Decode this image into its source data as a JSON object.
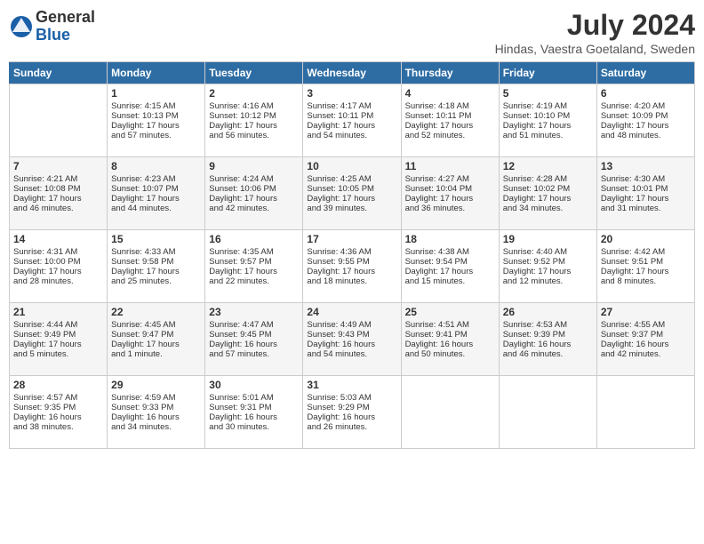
{
  "header": {
    "logo_general": "General",
    "logo_blue": "Blue",
    "title": "July 2024",
    "location": "Hindas, Vaestra Goetaland, Sweden"
  },
  "days_of_week": [
    "Sunday",
    "Monday",
    "Tuesday",
    "Wednesday",
    "Thursday",
    "Friday",
    "Saturday"
  ],
  "weeks": [
    [
      {
        "day": "",
        "info": ""
      },
      {
        "day": "1",
        "info": "Sunrise: 4:15 AM\nSunset: 10:13 PM\nDaylight: 17 hours\nand 57 minutes."
      },
      {
        "day": "2",
        "info": "Sunrise: 4:16 AM\nSunset: 10:12 PM\nDaylight: 17 hours\nand 56 minutes."
      },
      {
        "day": "3",
        "info": "Sunrise: 4:17 AM\nSunset: 10:11 PM\nDaylight: 17 hours\nand 54 minutes."
      },
      {
        "day": "4",
        "info": "Sunrise: 4:18 AM\nSunset: 10:11 PM\nDaylight: 17 hours\nand 52 minutes."
      },
      {
        "day": "5",
        "info": "Sunrise: 4:19 AM\nSunset: 10:10 PM\nDaylight: 17 hours\nand 51 minutes."
      },
      {
        "day": "6",
        "info": "Sunrise: 4:20 AM\nSunset: 10:09 PM\nDaylight: 17 hours\nand 48 minutes."
      }
    ],
    [
      {
        "day": "7",
        "info": "Sunrise: 4:21 AM\nSunset: 10:08 PM\nDaylight: 17 hours\nand 46 minutes."
      },
      {
        "day": "8",
        "info": "Sunrise: 4:23 AM\nSunset: 10:07 PM\nDaylight: 17 hours\nand 44 minutes."
      },
      {
        "day": "9",
        "info": "Sunrise: 4:24 AM\nSunset: 10:06 PM\nDaylight: 17 hours\nand 42 minutes."
      },
      {
        "day": "10",
        "info": "Sunrise: 4:25 AM\nSunset: 10:05 PM\nDaylight: 17 hours\nand 39 minutes."
      },
      {
        "day": "11",
        "info": "Sunrise: 4:27 AM\nSunset: 10:04 PM\nDaylight: 17 hours\nand 36 minutes."
      },
      {
        "day": "12",
        "info": "Sunrise: 4:28 AM\nSunset: 10:02 PM\nDaylight: 17 hours\nand 34 minutes."
      },
      {
        "day": "13",
        "info": "Sunrise: 4:30 AM\nSunset: 10:01 PM\nDaylight: 17 hours\nand 31 minutes."
      }
    ],
    [
      {
        "day": "14",
        "info": "Sunrise: 4:31 AM\nSunset: 10:00 PM\nDaylight: 17 hours\nand 28 minutes."
      },
      {
        "day": "15",
        "info": "Sunrise: 4:33 AM\nSunset: 9:58 PM\nDaylight: 17 hours\nand 25 minutes."
      },
      {
        "day": "16",
        "info": "Sunrise: 4:35 AM\nSunset: 9:57 PM\nDaylight: 17 hours\nand 22 minutes."
      },
      {
        "day": "17",
        "info": "Sunrise: 4:36 AM\nSunset: 9:55 PM\nDaylight: 17 hours\nand 18 minutes."
      },
      {
        "day": "18",
        "info": "Sunrise: 4:38 AM\nSunset: 9:54 PM\nDaylight: 17 hours\nand 15 minutes."
      },
      {
        "day": "19",
        "info": "Sunrise: 4:40 AM\nSunset: 9:52 PM\nDaylight: 17 hours\nand 12 minutes."
      },
      {
        "day": "20",
        "info": "Sunrise: 4:42 AM\nSunset: 9:51 PM\nDaylight: 17 hours\nand 8 minutes."
      }
    ],
    [
      {
        "day": "21",
        "info": "Sunrise: 4:44 AM\nSunset: 9:49 PM\nDaylight: 17 hours\nand 5 minutes."
      },
      {
        "day": "22",
        "info": "Sunrise: 4:45 AM\nSunset: 9:47 PM\nDaylight: 17 hours\nand 1 minute."
      },
      {
        "day": "23",
        "info": "Sunrise: 4:47 AM\nSunset: 9:45 PM\nDaylight: 16 hours\nand 57 minutes."
      },
      {
        "day": "24",
        "info": "Sunrise: 4:49 AM\nSunset: 9:43 PM\nDaylight: 16 hours\nand 54 minutes."
      },
      {
        "day": "25",
        "info": "Sunrise: 4:51 AM\nSunset: 9:41 PM\nDaylight: 16 hours\nand 50 minutes."
      },
      {
        "day": "26",
        "info": "Sunrise: 4:53 AM\nSunset: 9:39 PM\nDaylight: 16 hours\nand 46 minutes."
      },
      {
        "day": "27",
        "info": "Sunrise: 4:55 AM\nSunset: 9:37 PM\nDaylight: 16 hours\nand 42 minutes."
      }
    ],
    [
      {
        "day": "28",
        "info": "Sunrise: 4:57 AM\nSunset: 9:35 PM\nDaylight: 16 hours\nand 38 minutes."
      },
      {
        "day": "29",
        "info": "Sunrise: 4:59 AM\nSunset: 9:33 PM\nDaylight: 16 hours\nand 34 minutes."
      },
      {
        "day": "30",
        "info": "Sunrise: 5:01 AM\nSunset: 9:31 PM\nDaylight: 16 hours\nand 30 minutes."
      },
      {
        "day": "31",
        "info": "Sunrise: 5:03 AM\nSunset: 9:29 PM\nDaylight: 16 hours\nand 26 minutes."
      },
      {
        "day": "",
        "info": ""
      },
      {
        "day": "",
        "info": ""
      },
      {
        "day": "",
        "info": ""
      }
    ]
  ]
}
